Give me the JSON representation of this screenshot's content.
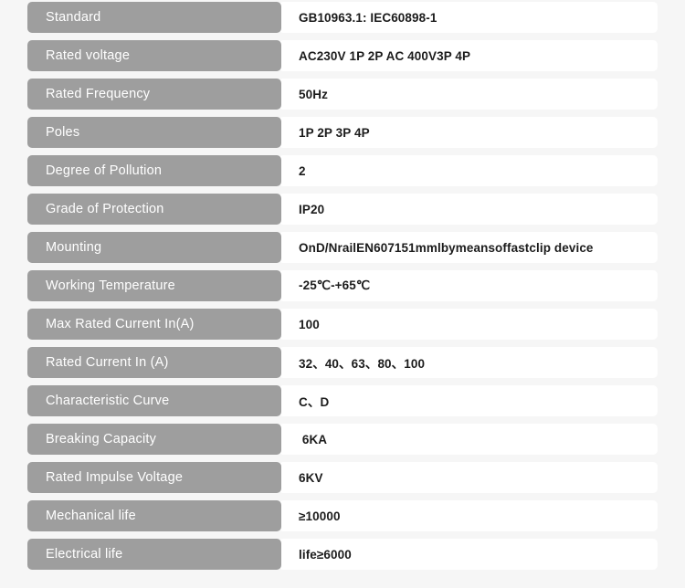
{
  "table": {
    "rows": [
      {
        "label": "Standard",
        "value": "GB10963.1: IEC60898-1"
      },
      {
        "label": "Rated voltage",
        "value": "AC230V 1P 2P AC 400V3P 4P"
      },
      {
        "label": "Rated Frequency",
        "value": "50Hz"
      },
      {
        "label": "Poles",
        "value": "1P 2P 3P 4P"
      },
      {
        "label": "Degree of Pollution",
        "value": "2"
      },
      {
        "label": "Grade of Protection",
        "value": "IP20"
      },
      {
        "label": "Mounting",
        "value": "OnD/NrailEN607151mmlbymeansoffastclip device"
      },
      {
        "label": "Working Temperature",
        "value": "-25℃-+65℃"
      },
      {
        "label": "Max Rated Current In(A)",
        "value": "100"
      },
      {
        "label": "Rated Current In (A)",
        "value": "32、40、63、80、100"
      },
      {
        "label": "Characteristic Curve",
        "value": "C、D"
      },
      {
        "label": "Breaking Capacity",
        "value": " 6KA"
      },
      {
        "label": "Rated Impulse Voltage",
        "value": "6KV"
      },
      {
        "label": "Mechanical life",
        "value": "≥10000"
      },
      {
        "label": "Electrical life",
        "value": "life≥6000"
      }
    ]
  },
  "colors": {
    "page_background": "#f6f6f6",
    "label_background": "#9e9e9e",
    "value_background": "#ffffff",
    "label_text": "#ffffff",
    "value_text": "#1c1c1c"
  }
}
